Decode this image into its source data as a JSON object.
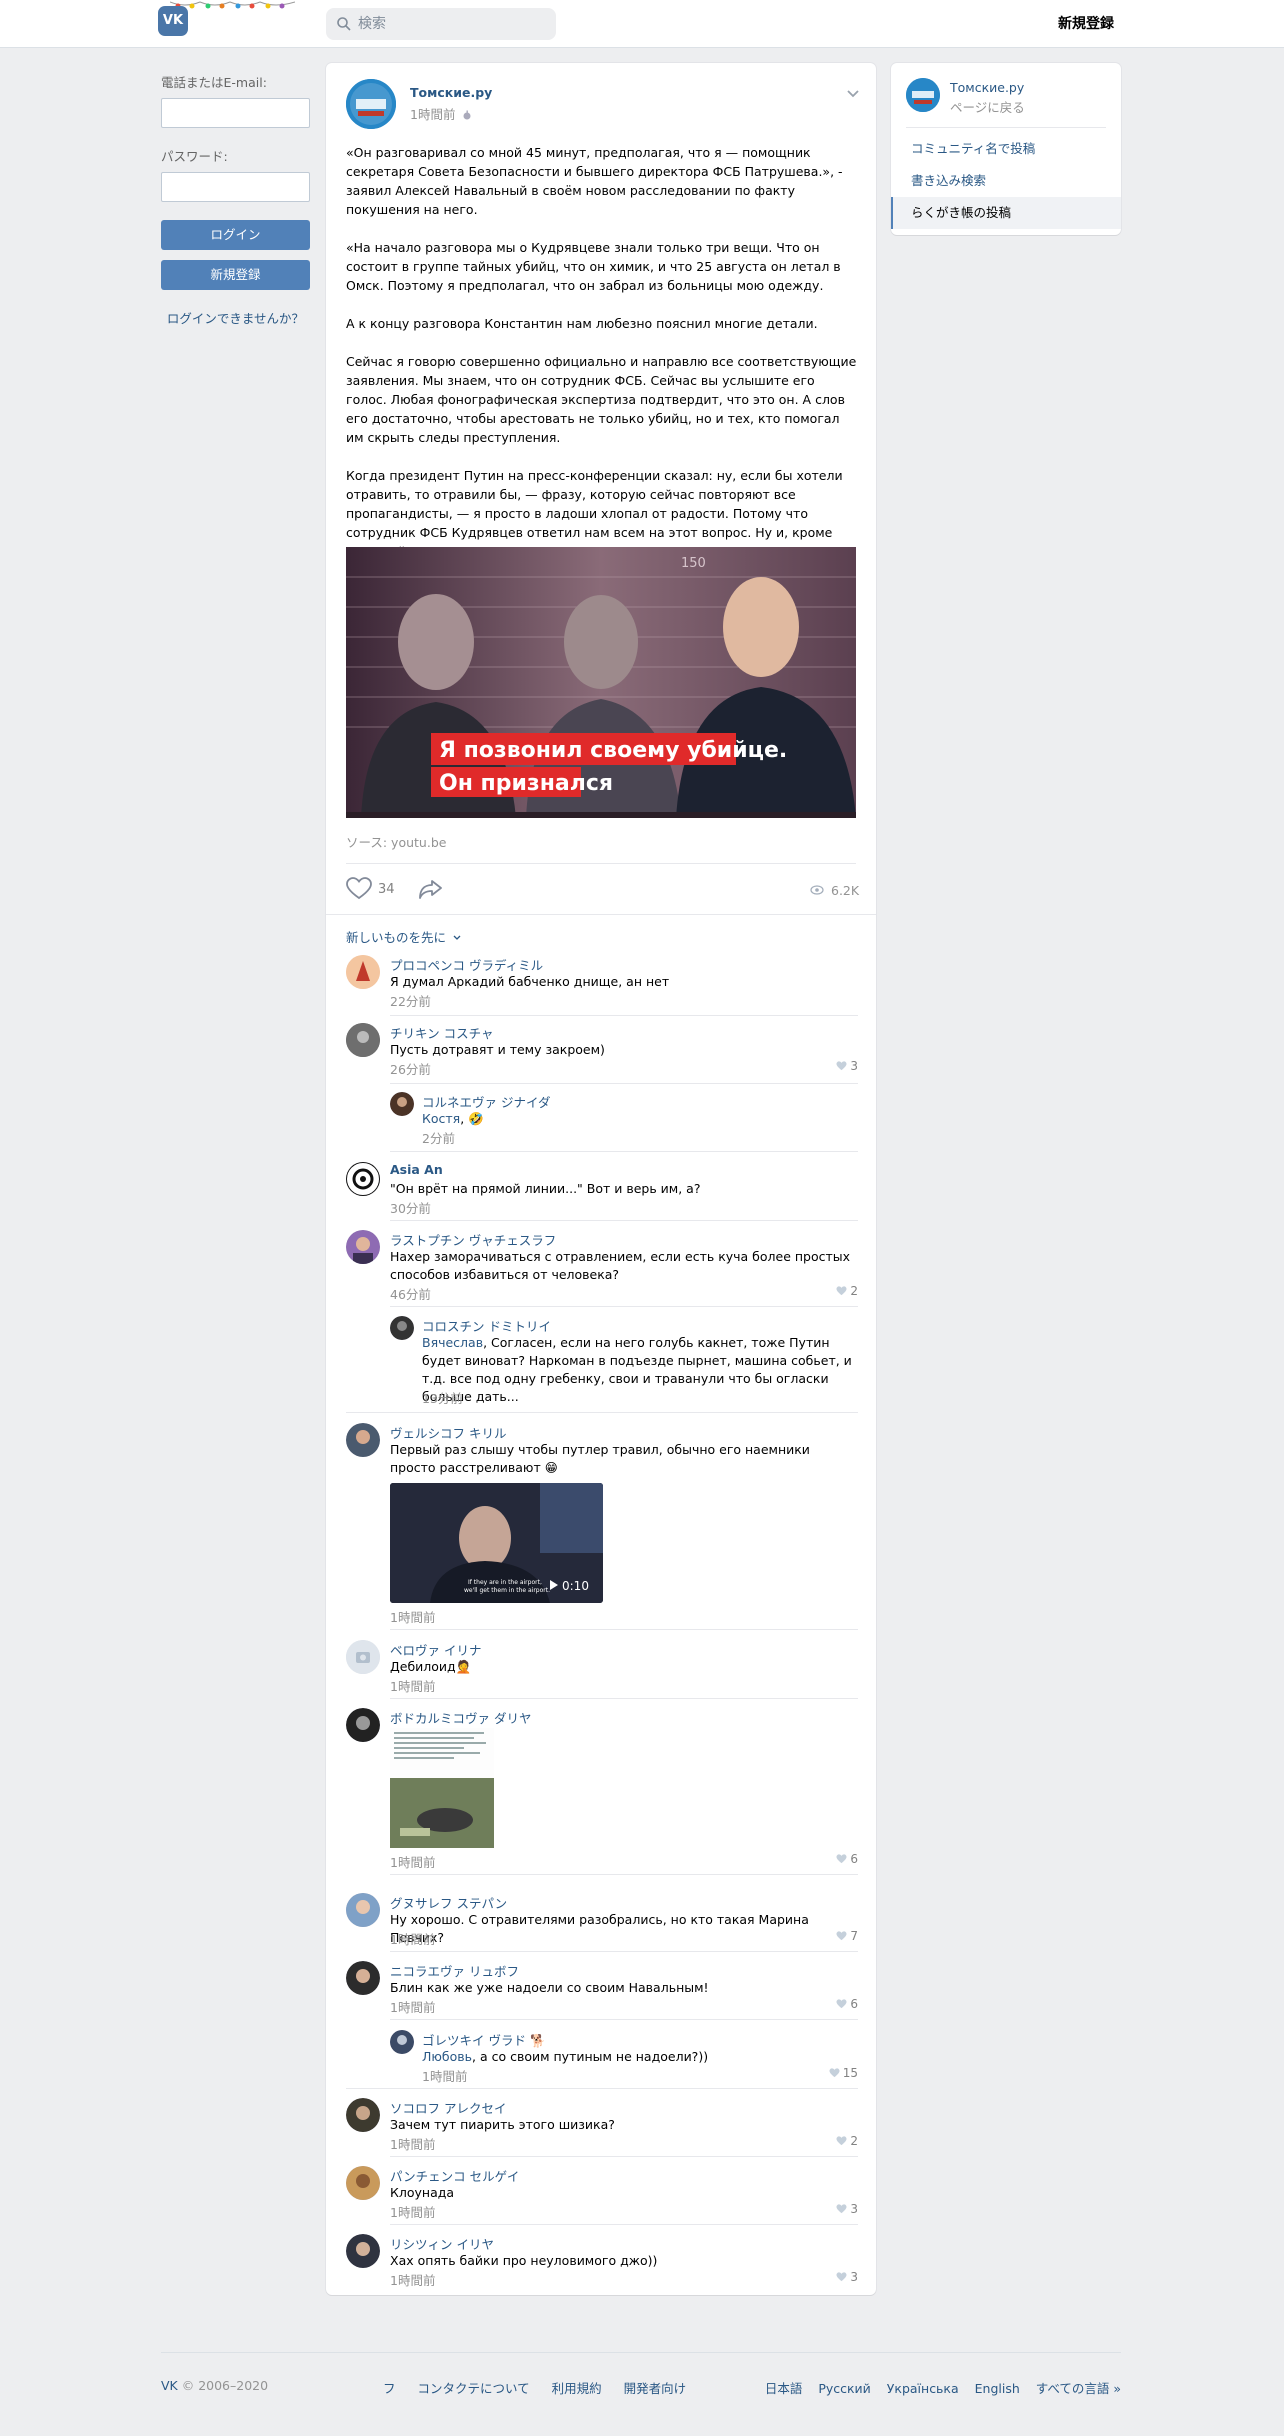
{
  "header": {
    "logo_text": "VK",
    "search_placeholder": "検索",
    "register_label": "新規登録"
  },
  "login": {
    "email_label": "電話またはE-mail:",
    "password_label": "パスワード:",
    "login_button": "ログイン",
    "register_button": "新規登録",
    "forgot_link": "ログインできませんか？"
  },
  "post": {
    "author": "Томские.ру",
    "time": "1時間前",
    "paragraphs": [
      "«Он разговаривал со мной 45 минут, предполагая, что я — помощник секретаря Совета Безопасности и бывшего директора ФСБ Патрушева.», - заявил Алексей Навальный в своём новом расследовании по факту покушения на него.",
      "«На начало разговора мы о Кудрявцеве знали только три вещи. Что он состоит в группе тайных убийц, что он химик, и что 25 августа он летал в Омск. Поэтому я предполагал, что он забрал из больницы мою одежду.",
      "А к концу разговора Константин нам любезно пояснил многие детали.",
      "Сейчас я говорю совершенно официально и направлю все соответствующие заявления. Мы знаем, что он сотрудник ФСБ. Сейчас вы услышите его голос. Любая фонографическая экспертиза подтвердит, что это он. А слов его достаточно, чтобы арестовать не только убийц, но и тех, кто помогал им скрыть следы преступления.",
      "Когда президент Путин на пресс-конференции сказал: ну, если бы хотели отравить, то отравили бы, — фразу, которую сейчас повторяют все пропагандисты, — я просто в ладоши хлопал от радости. Потому что сотрудник ФСБ Кудрявцев ответил нам всем на этот вопрос. Ну и, кроме того, сейчас вы узнаете, почему Путин много думает о моих, извините, трусах.»."
    ],
    "image_caption_line1": "Я позвонил своему убийце.",
    "image_caption_line2": "Он признался",
    "image_height_mark": "150",
    "source": "ソース: youtu.be",
    "likes": "34",
    "views": "6.2K",
    "sort_label": "新しいものを先に"
  },
  "comments": [
    {
      "name": "プロコペンコ ヴラディミル",
      "text": "Я думал Аркадий бабченко днище, ан нет",
      "time": "22分前",
      "likes": ""
    },
    {
      "name": "チリキン コスチャ",
      "text": "Пусть дотравят и тему закроем)",
      "time": "26分前",
      "likes": "3"
    },
    {
      "name": "コルネエヴァ ジナイダ",
      "mention": "Костя",
      "text": ", 🤣",
      "time": "2分前",
      "likes": ""
    },
    {
      "name": "Asia An",
      "text": "\"Он врёт на прямой линии...\" Вот и верь им, а?",
      "time": "30分前",
      "likes": ""
    },
    {
      "name": "ラストプチン ヴャチェスラフ",
      "text": "Нахер заморачиваться с отравлением, если есть куча более простых способов избавиться от человека?",
      "time": "46分前",
      "likes": "2"
    },
    {
      "name": "コロスチン ドミトリイ",
      "mention": "Вячеслав",
      "text": ", Согласен, если на него голубь какнет, тоже Путин будет виноват? Наркоман в подъезде пырнет, машина собьет, и т.д. все под одну гребенку, свои и траванули что бы огласки больше дать...",
      "time": "13分前",
      "likes": ""
    },
    {
      "name": "ヴェルシコフ キリル",
      "text": "Первый раз слышу чтобы путлер травил, обычно его наемники просто расстреливают 😁",
      "time": "1時間前",
      "likes": "",
      "video_duration": "0:10",
      "video_subtitle_1": "If they are in the airport,",
      "video_subtitle_2": "we'll get them in the airport."
    },
    {
      "name": "ベロヴァ イリナ",
      "text": "Дебилоид🤦",
      "time": "1時間前",
      "likes": ""
    },
    {
      "name": "ボドカルミコヴァ ダリヤ",
      "text": "",
      "time": "1時間前",
      "likes": "6"
    },
    {
      "name": "グヌサレフ ステパン",
      "text": "Ну хорошо. С отравителями разобрались, но кто такая Марина Певчих?",
      "time": "1時間前",
      "likes": "7"
    },
    {
      "name": "ニコラエヴァ リュボフ",
      "text": "Блин как же уже надоели со своим Навальным!",
      "time": "1時間前",
      "likes": "6"
    },
    {
      "name": "ゴレツキイ ヴラド 🐕",
      "mention": "Любовь",
      "text": ", а со своим путиным не надоели?))",
      "time": "1時間前",
      "likes": "15"
    },
    {
      "name": "ソコロフ アレクセイ",
      "text": "Зачем тут пиарить этого шизика?",
      "time": "1時間前",
      "likes": "2"
    },
    {
      "name": "パンチェンコ セルゲイ",
      "text": "Клоунада",
      "time": "1時間前",
      "likes": "3"
    },
    {
      "name": "リシツィン イリヤ",
      "text": "Хах опять байки про неуловимого джо))",
      "time": "1時間前",
      "likes": "3"
    }
  ],
  "sidebar": {
    "name": "Томские.ру",
    "back": "ページに戻る",
    "items": [
      "コミュニティ名で投稿",
      "書き込み検索",
      "らくがき帳の投稿"
    ]
  },
  "footer": {
    "brand": "VK",
    "copyright": " © 2006–2020",
    "links": [
      "フ",
      "コンタクテについて",
      "利用規約",
      "開発者向け"
    ],
    "languages": [
      "日本語",
      "Русский",
      "Українська",
      "English",
      "すべての言語 »"
    ]
  },
  "colors": {
    "accent": "#5181b8",
    "link": "#2a5885",
    "background": "#edeef0"
  }
}
